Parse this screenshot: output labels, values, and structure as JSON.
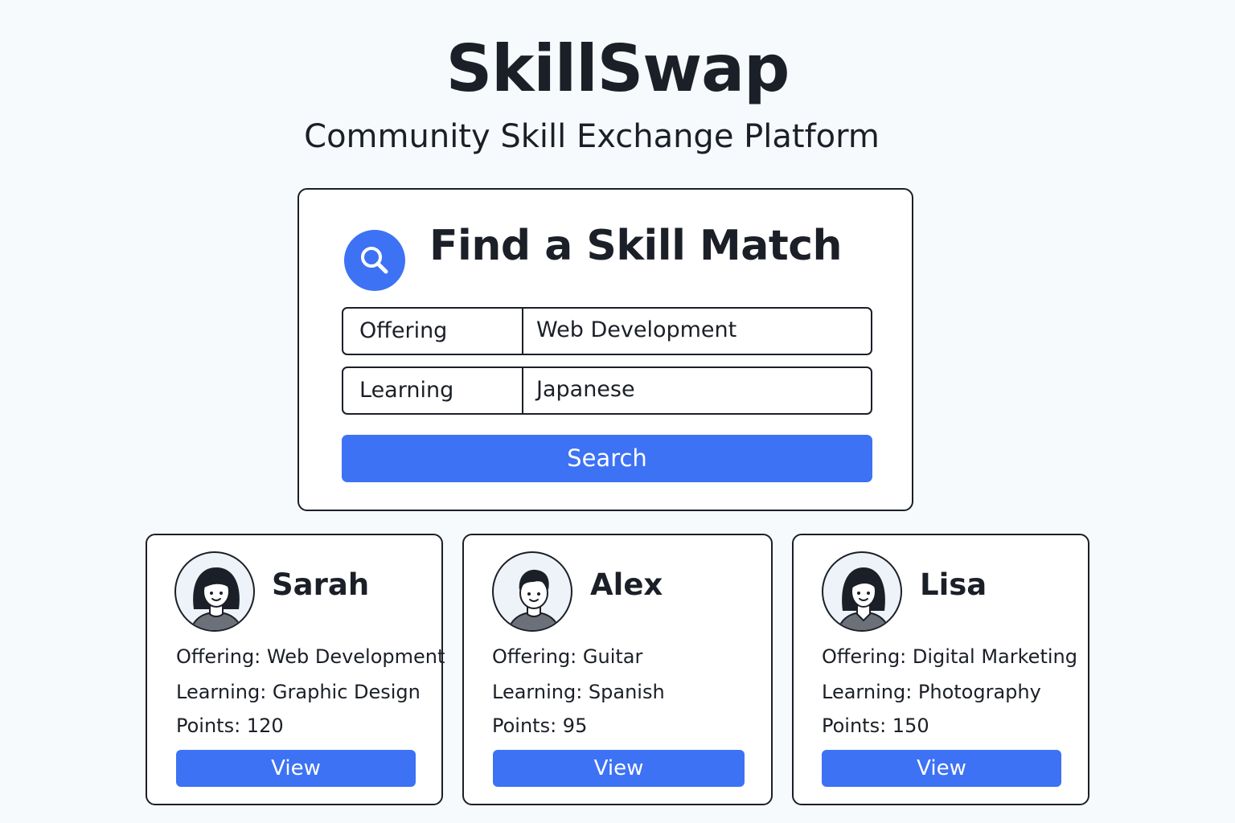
{
  "header": {
    "title": "SkillSwap",
    "subtitle": "Community Skill Exchange Platform"
  },
  "search": {
    "icon": "search-icon",
    "heading": "Find a Skill Match",
    "offering_label": "Offering",
    "offering_value": "Web Development",
    "learning_label": "Learning",
    "learning_value": "Japanese",
    "button_label": "Search"
  },
  "profiles": [
    {
      "name": "Sarah",
      "avatar_icon": "female-avatar-icon",
      "offering": "Offering: Web Development",
      "learning": "Learning: Graphic Design",
      "points": "Points: 120",
      "view_label": "View"
    },
    {
      "name": "Alex",
      "avatar_icon": "male-avatar-icon",
      "offering": "Offering: Guitar",
      "learning": "Learning: Spanish",
      "points": "Points: 95",
      "view_label": "View"
    },
    {
      "name": "Lisa",
      "avatar_icon": "female-avatar-icon",
      "offering": "Offering: Digital Marketing",
      "learning": "Learning: Photography",
      "points": "Points: 150",
      "view_label": "View"
    }
  ],
  "colors": {
    "accent": "#3d72f4",
    "background": "#f6fafd",
    "text": "#1b1f27"
  }
}
